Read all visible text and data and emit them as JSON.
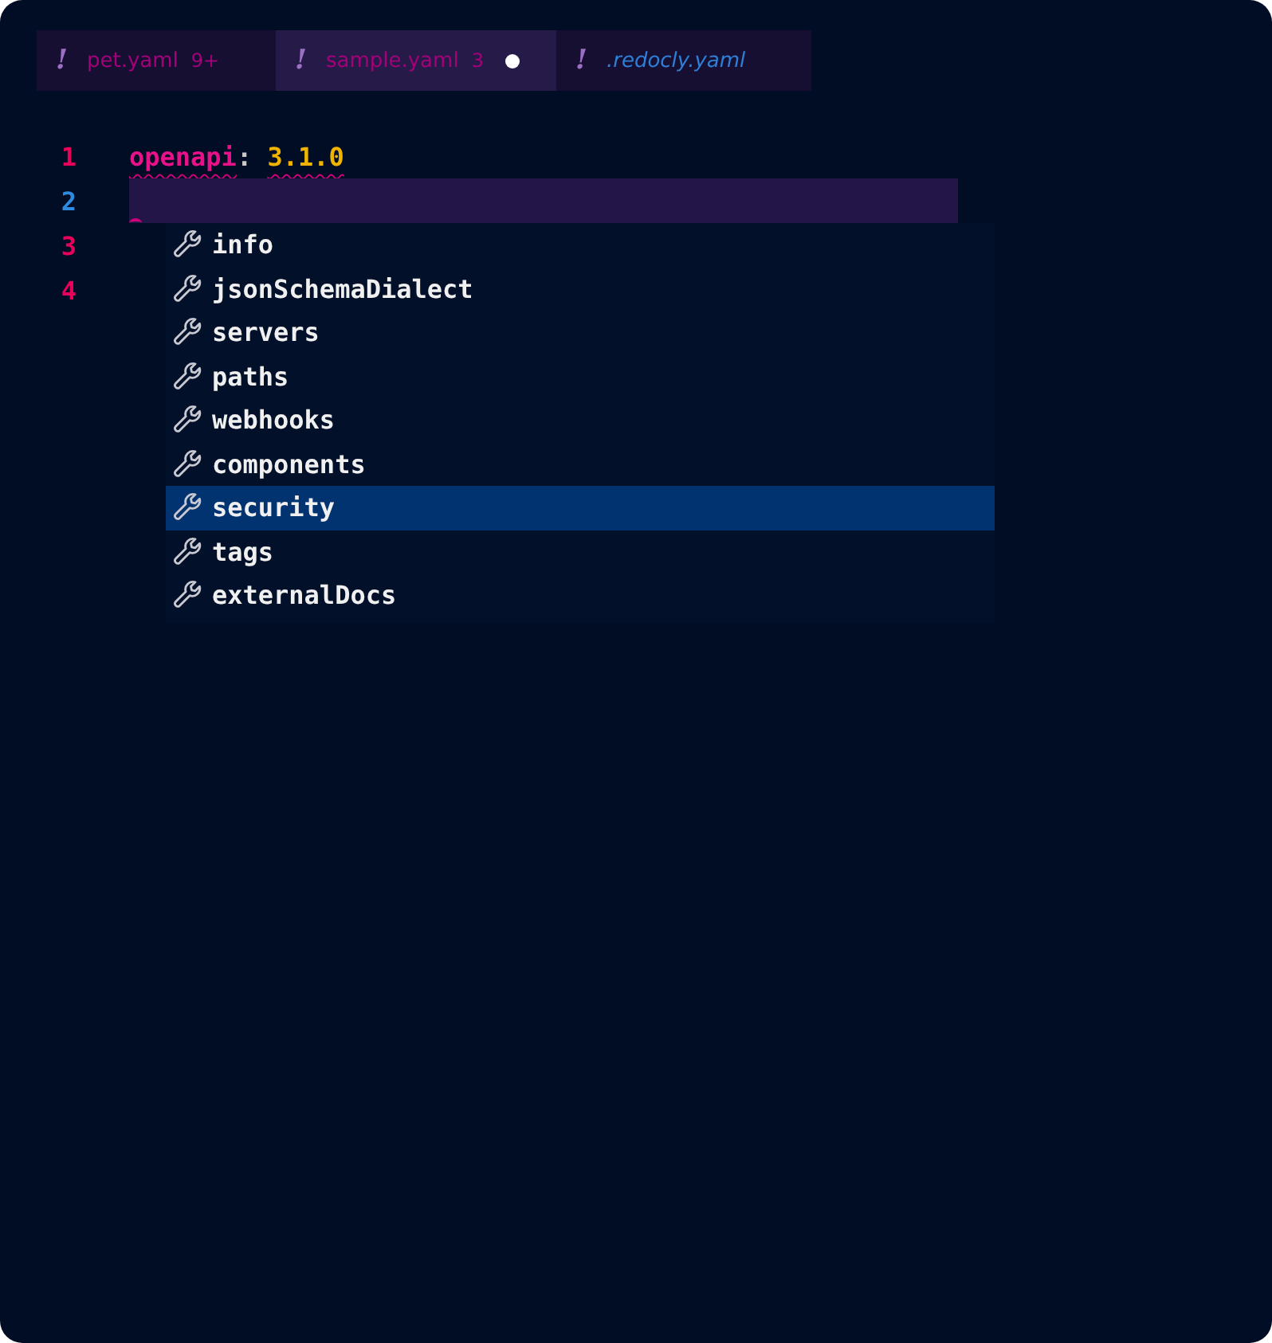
{
  "tabs": [
    {
      "icon": "!",
      "label": "pet.yaml",
      "badge": "9+",
      "kind": "file",
      "modified": false,
      "selected": false
    },
    {
      "icon": "!",
      "label": "sample.yaml",
      "badge": "3",
      "kind": "file",
      "modified": true,
      "selected": true
    },
    {
      "icon": "!",
      "label": ".redocly.yaml",
      "kind": "config",
      "modified": false,
      "selected": false
    }
  ],
  "editor": {
    "lines": [
      {
        "number": "1",
        "current": false,
        "key": "openapi",
        "colon": ":",
        "value": "3.1.0",
        "error": true
      },
      {
        "number": "2",
        "current": true,
        "error": true
      },
      {
        "number": "3",
        "current": false
      },
      {
        "number": "4",
        "current": false
      }
    ],
    "suggestions": [
      {
        "label": "info",
        "selected": false
      },
      {
        "label": "jsonSchemaDialect",
        "selected": false
      },
      {
        "label": "servers",
        "selected": false
      },
      {
        "label": "paths",
        "selected": false
      },
      {
        "label": "webhooks",
        "selected": false
      },
      {
        "label": "components",
        "selected": false
      },
      {
        "label": "security",
        "selected": true
      },
      {
        "label": "tags",
        "selected": false
      },
      {
        "label": "externalDocs",
        "selected": false
      }
    ]
  }
}
